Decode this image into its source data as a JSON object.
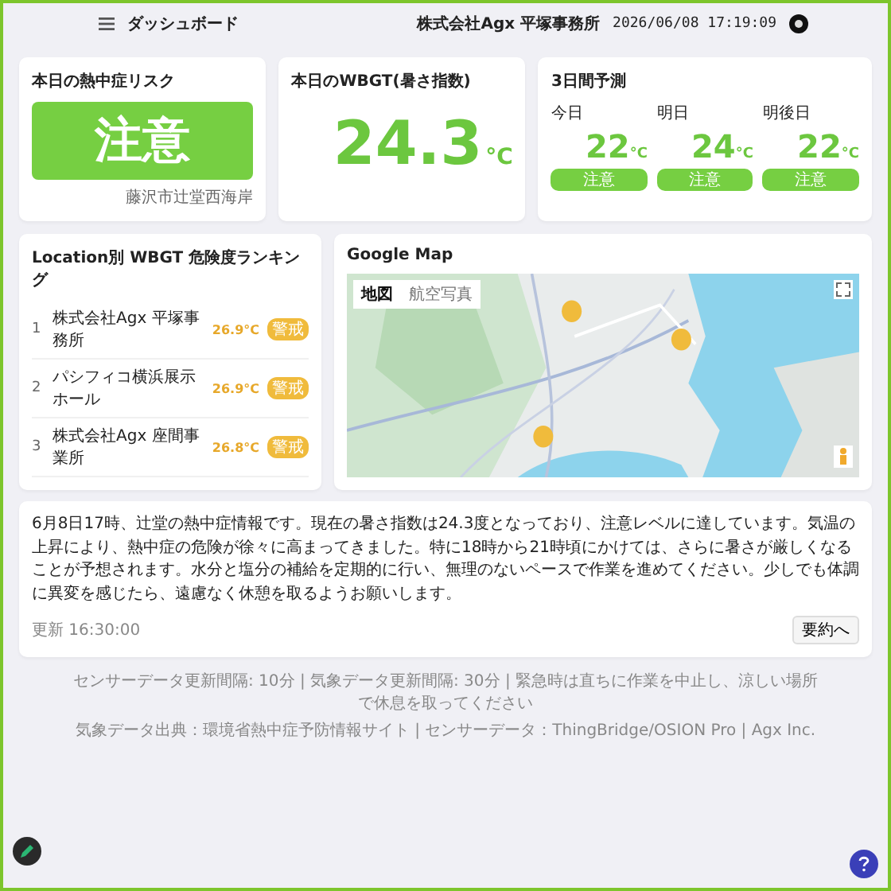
{
  "header": {
    "title": "ダッシュボード",
    "office": "株式会社Agx 平塚事務所",
    "datetime": "2026/06/08 17:19:09"
  },
  "risk": {
    "title": "本日の熱中症リスク",
    "level": "注意",
    "location": "藤沢市辻堂西海岸"
  },
  "wbgt": {
    "title": "本日のWBGT(暑さ指数)",
    "value": "24.3",
    "unit": "°C"
  },
  "forecast": {
    "title": "3日間予測",
    "days": [
      {
        "label": "今日",
        "value": "22",
        "unit": "°C",
        "risk": "注意"
      },
      {
        "label": "明日",
        "value": "24",
        "unit": "°C",
        "risk": "注意"
      },
      {
        "label": "明後日",
        "value": "22",
        "unit": "°C",
        "risk": "注意"
      }
    ]
  },
  "ranking": {
    "title": "Location別 WBGT 危険度ランキング",
    "rows": [
      {
        "rank": "1",
        "name": "株式会社Agx 平塚事務所",
        "value": "26.9°C",
        "risk": "警戒"
      },
      {
        "rank": "2",
        "name": "パシフィコ横浜展示ホール",
        "value": "26.9°C",
        "risk": "警戒"
      },
      {
        "rank": "3",
        "name": "株式会社Agx 座間事業所",
        "value": "26.8°C",
        "risk": "警戒"
      }
    ]
  },
  "map": {
    "title": "Google Map",
    "tabs": [
      {
        "label": "地図",
        "selected": true
      },
      {
        "label": "航空写真",
        "selected": false
      }
    ]
  },
  "message": {
    "text": "6月8日17時、辻堂の熱中症情報です。現在の暑さ指数は24.3度となっており、注意レベルに達しています。気温の上昇により、熱中症の危険が徐々に高まってきました。特に18時から21時頃にかけては、さらに暑さが厳しくなることが予想されます。水分と塩分の補給を定期的に行い、無理のないペースで作業を進めてください。少しでも体調に異変を感じたら、遠慮なく休憩を取るようお願いします。",
    "time": "更新 16:30:00",
    "button": "要約へ"
  },
  "footer": [
    "センサーデータ更新間隔: 10分 | 気象データ更新間隔: 30分 | 緊急時は直ちに作業を中止し、涼しい場所で休息を取ってください",
    "気象データ出典：環境省熱中症予防情報サイト | センサーデータ：ThingBridge/OSION Pro | Agx Inc."
  ]
}
